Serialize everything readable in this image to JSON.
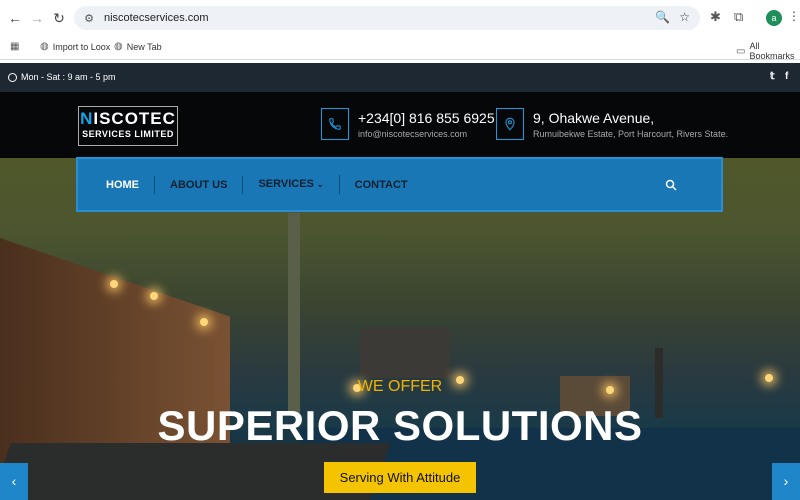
{
  "browser": {
    "url": "niscotecservices.com",
    "profile_initial": "a",
    "bookmarks": [
      {
        "label": "Import to Loox"
      },
      {
        "label": "New Tab"
      }
    ],
    "all_bookmarks_label": "All Bookmarks"
  },
  "topbar": {
    "hours": "Mon - Sat : 9 am - 5 pm",
    "social": [
      "twitter-icon",
      "facebook-icon"
    ]
  },
  "header": {
    "logo_line1_accent": "N",
    "logo_line1_rest": "ISCOTEC",
    "logo_line2": "SERVICES LIMITED",
    "phone": "+234[0] 816 855 6925",
    "email": "info@niscotecservices.com",
    "address_line1": "9, Ohakwe Avenue,",
    "address_line2": "Rumuibekwe Estate, Port Harcourt, Rivers State."
  },
  "nav": {
    "items": [
      {
        "label": "HOME"
      },
      {
        "label": "ABOUT US"
      },
      {
        "label": "SERVICES"
      },
      {
        "label": "CONTACT"
      }
    ]
  },
  "hero": {
    "kicker": "WE OFFER",
    "headline": "SUPERIOR SOLUTIONS",
    "cta": "Serving With Attitude"
  },
  "colors": {
    "brand_blue": "#1877b4",
    "accent_yellow": "#f5c400",
    "topbar_bg": "#1d2833",
    "header_bg": "#050709"
  }
}
